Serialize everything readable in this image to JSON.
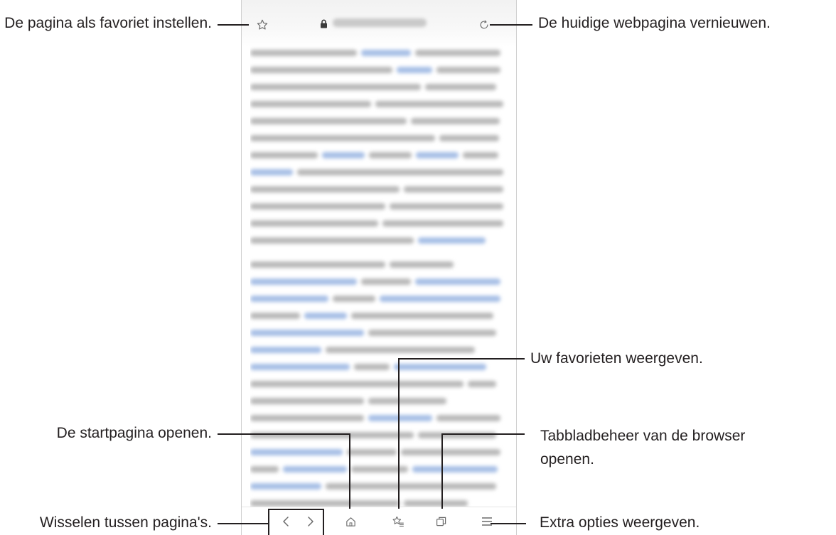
{
  "callouts": {
    "favorite": "De pagina als favoriet instellen.",
    "refresh": "De huidige webpagina vernieuwen.",
    "bookmarks": "Uw favorieten weergeven.",
    "home": "De startpagina openen.",
    "tabs_line1": "Tabbladbeheer van de browser",
    "tabs_line2": "openen.",
    "navigate": "Wisselen tussen pagina's.",
    "more": "Extra opties weergeven."
  },
  "icons": {
    "favorite": "star-outline-icon",
    "secure": "lock-icon",
    "refresh": "refresh-icon",
    "back": "chevron-left-icon",
    "forward": "chevron-right-icon",
    "home": "home-icon",
    "bookmarks": "bookmarks-list-icon",
    "tabs": "tabs-icon",
    "menu": "menu-icon"
  },
  "colors": {
    "text": "#231f20",
    "icon": "#6a6a6a",
    "blurred_text": "#b9b9b9",
    "blurred_link": "#a7bfe6"
  }
}
